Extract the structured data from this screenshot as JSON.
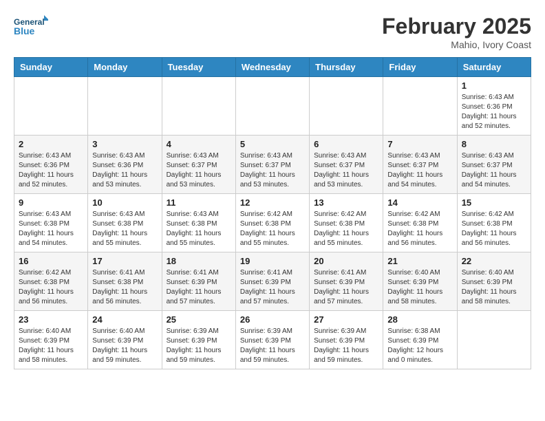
{
  "header": {
    "logo_general": "General",
    "logo_blue": "Blue",
    "month_title": "February 2025",
    "location": "Mahio, Ivory Coast"
  },
  "weekdays": [
    "Sunday",
    "Monday",
    "Tuesday",
    "Wednesday",
    "Thursday",
    "Friday",
    "Saturday"
  ],
  "weeks": [
    [
      {
        "day": "",
        "info": ""
      },
      {
        "day": "",
        "info": ""
      },
      {
        "day": "",
        "info": ""
      },
      {
        "day": "",
        "info": ""
      },
      {
        "day": "",
        "info": ""
      },
      {
        "day": "",
        "info": ""
      },
      {
        "day": "1",
        "info": "Sunrise: 6:43 AM\nSunset: 6:36 PM\nDaylight: 11 hours and 52 minutes."
      }
    ],
    [
      {
        "day": "2",
        "info": "Sunrise: 6:43 AM\nSunset: 6:36 PM\nDaylight: 11 hours and 52 minutes."
      },
      {
        "day": "3",
        "info": "Sunrise: 6:43 AM\nSunset: 6:36 PM\nDaylight: 11 hours and 53 minutes."
      },
      {
        "day": "4",
        "info": "Sunrise: 6:43 AM\nSunset: 6:37 PM\nDaylight: 11 hours and 53 minutes."
      },
      {
        "day": "5",
        "info": "Sunrise: 6:43 AM\nSunset: 6:37 PM\nDaylight: 11 hours and 53 minutes."
      },
      {
        "day": "6",
        "info": "Sunrise: 6:43 AM\nSunset: 6:37 PM\nDaylight: 11 hours and 53 minutes."
      },
      {
        "day": "7",
        "info": "Sunrise: 6:43 AM\nSunset: 6:37 PM\nDaylight: 11 hours and 54 minutes."
      },
      {
        "day": "8",
        "info": "Sunrise: 6:43 AM\nSunset: 6:37 PM\nDaylight: 11 hours and 54 minutes."
      }
    ],
    [
      {
        "day": "9",
        "info": "Sunrise: 6:43 AM\nSunset: 6:38 PM\nDaylight: 11 hours and 54 minutes."
      },
      {
        "day": "10",
        "info": "Sunrise: 6:43 AM\nSunset: 6:38 PM\nDaylight: 11 hours and 55 minutes."
      },
      {
        "day": "11",
        "info": "Sunrise: 6:43 AM\nSunset: 6:38 PM\nDaylight: 11 hours and 55 minutes."
      },
      {
        "day": "12",
        "info": "Sunrise: 6:42 AM\nSunset: 6:38 PM\nDaylight: 11 hours and 55 minutes."
      },
      {
        "day": "13",
        "info": "Sunrise: 6:42 AM\nSunset: 6:38 PM\nDaylight: 11 hours and 55 minutes."
      },
      {
        "day": "14",
        "info": "Sunrise: 6:42 AM\nSunset: 6:38 PM\nDaylight: 11 hours and 56 minutes."
      },
      {
        "day": "15",
        "info": "Sunrise: 6:42 AM\nSunset: 6:38 PM\nDaylight: 11 hours and 56 minutes."
      }
    ],
    [
      {
        "day": "16",
        "info": "Sunrise: 6:42 AM\nSunset: 6:38 PM\nDaylight: 11 hours and 56 minutes."
      },
      {
        "day": "17",
        "info": "Sunrise: 6:41 AM\nSunset: 6:38 PM\nDaylight: 11 hours and 56 minutes."
      },
      {
        "day": "18",
        "info": "Sunrise: 6:41 AM\nSunset: 6:39 PM\nDaylight: 11 hours and 57 minutes."
      },
      {
        "day": "19",
        "info": "Sunrise: 6:41 AM\nSunset: 6:39 PM\nDaylight: 11 hours and 57 minutes."
      },
      {
        "day": "20",
        "info": "Sunrise: 6:41 AM\nSunset: 6:39 PM\nDaylight: 11 hours and 57 minutes."
      },
      {
        "day": "21",
        "info": "Sunrise: 6:40 AM\nSunset: 6:39 PM\nDaylight: 11 hours and 58 minutes."
      },
      {
        "day": "22",
        "info": "Sunrise: 6:40 AM\nSunset: 6:39 PM\nDaylight: 11 hours and 58 minutes."
      }
    ],
    [
      {
        "day": "23",
        "info": "Sunrise: 6:40 AM\nSunset: 6:39 PM\nDaylight: 11 hours and 58 minutes."
      },
      {
        "day": "24",
        "info": "Sunrise: 6:40 AM\nSunset: 6:39 PM\nDaylight: 11 hours and 59 minutes."
      },
      {
        "day": "25",
        "info": "Sunrise: 6:39 AM\nSunset: 6:39 PM\nDaylight: 11 hours and 59 minutes."
      },
      {
        "day": "26",
        "info": "Sunrise: 6:39 AM\nSunset: 6:39 PM\nDaylight: 11 hours and 59 minutes."
      },
      {
        "day": "27",
        "info": "Sunrise: 6:39 AM\nSunset: 6:39 PM\nDaylight: 11 hours and 59 minutes."
      },
      {
        "day": "28",
        "info": "Sunrise: 6:38 AM\nSunset: 6:39 PM\nDaylight: 12 hours and 0 minutes."
      },
      {
        "day": "",
        "info": ""
      }
    ]
  ]
}
